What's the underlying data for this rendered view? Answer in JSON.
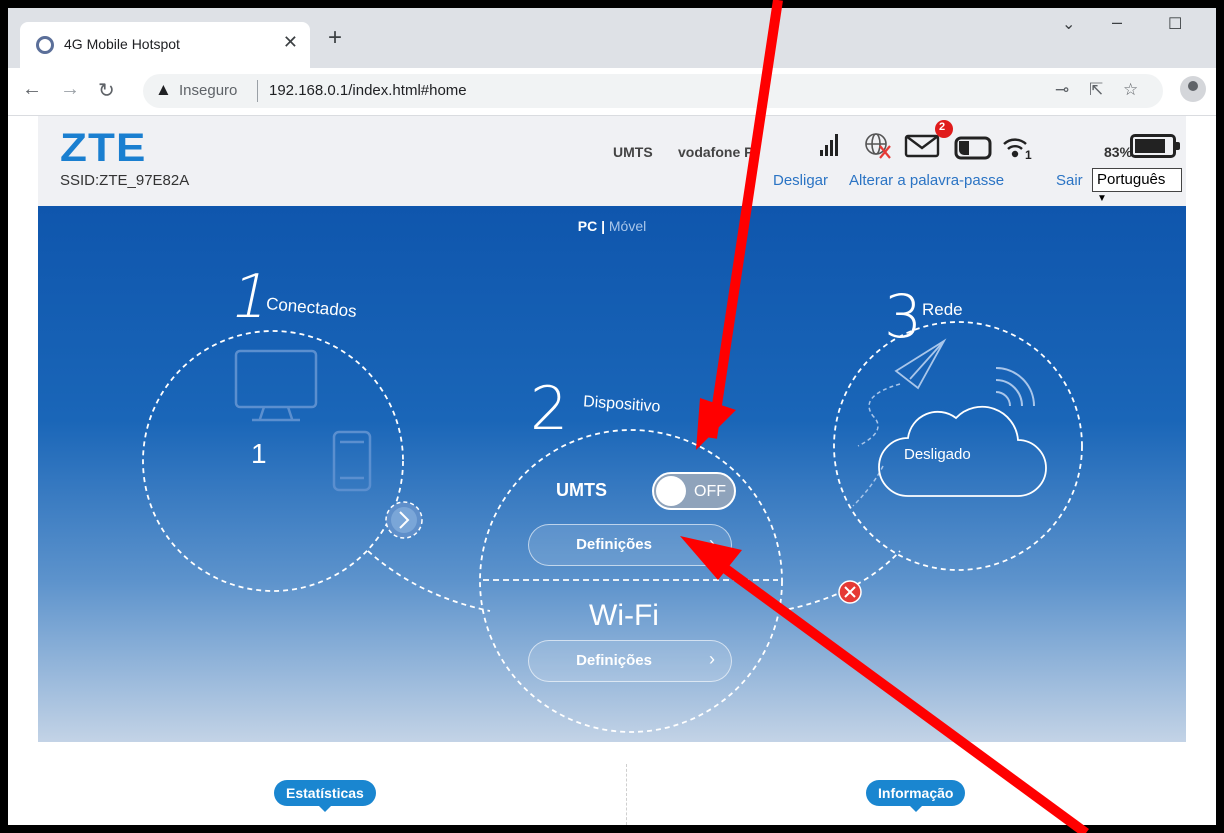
{
  "browser": {
    "tab_title": "4G Mobile Hotspot",
    "insecure_label": "Inseguro",
    "url": "192.168.0.1/index.html#home"
  },
  "header": {
    "logo": "ZTE",
    "ssid": "SSID:ZTE_97E82A",
    "network_type": "UMTS",
    "operator": "vodafone P",
    "sms_count": "2",
    "battery": "83%",
    "battery_level": 0.83,
    "wifi_clients": "1",
    "links": {
      "disconnect": "Desligar",
      "change_password": "Alterar a palavra-passe",
      "logout": "Sair"
    },
    "language": "Português"
  },
  "hero": {
    "mode_pc": "PC",
    "mode_sep": "|",
    "mode_mobile": "Móvel",
    "connected": {
      "number": "1",
      "title": "Conectados",
      "count": "1"
    },
    "device": {
      "number": "2",
      "title": "Dispositivo",
      "umts_label": "UMTS",
      "toggle_state": "OFF",
      "umts_settings": "Definições",
      "wifi_label": "Wi-Fi",
      "wifi_settings": "Definições"
    },
    "network": {
      "number": "3",
      "title": "Rede",
      "status": "Desligado"
    }
  },
  "bottom": {
    "stats_tab": "Estatísticas",
    "info_tab": "Informação"
  },
  "colors": {
    "accent": "#1a7fd0",
    "annotation_arrow": "#ff0000",
    "error": "#e53935"
  }
}
